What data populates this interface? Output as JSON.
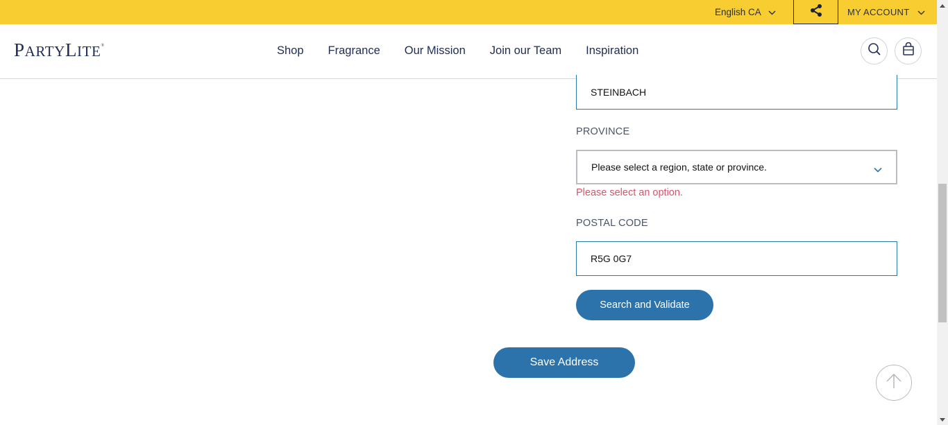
{
  "topbar": {
    "language": "English CA",
    "account": "MY ACCOUNT"
  },
  "header": {
    "logo_main": "PARTY",
    "logo_second": "LITE",
    "nav": [
      {
        "label": "Shop"
      },
      {
        "label": "Fragrance"
      },
      {
        "label": "Our Mission"
      },
      {
        "label": "Join our Team"
      },
      {
        "label": "Inspiration"
      }
    ]
  },
  "form": {
    "city_value": "STEINBACH",
    "province_label": "PROVINCE",
    "province_placeholder": "Please select a region, state or province.",
    "province_error": "Please select an option.",
    "postal_label": "POSTAL CODE",
    "postal_value": "R5G 0G7",
    "validate_button": "Search and Validate",
    "save_button": "Save Address"
  },
  "colors": {
    "topbar": "#f8cd31",
    "brand_navy": "#1e2c55",
    "button_blue": "#2c73ac",
    "input_border": "#2979a8",
    "error": "#d9536b"
  },
  "icons": [
    "chevron-down-icon",
    "share-icon",
    "search-icon",
    "shopping-bag-icon",
    "arrow-up-icon"
  ]
}
